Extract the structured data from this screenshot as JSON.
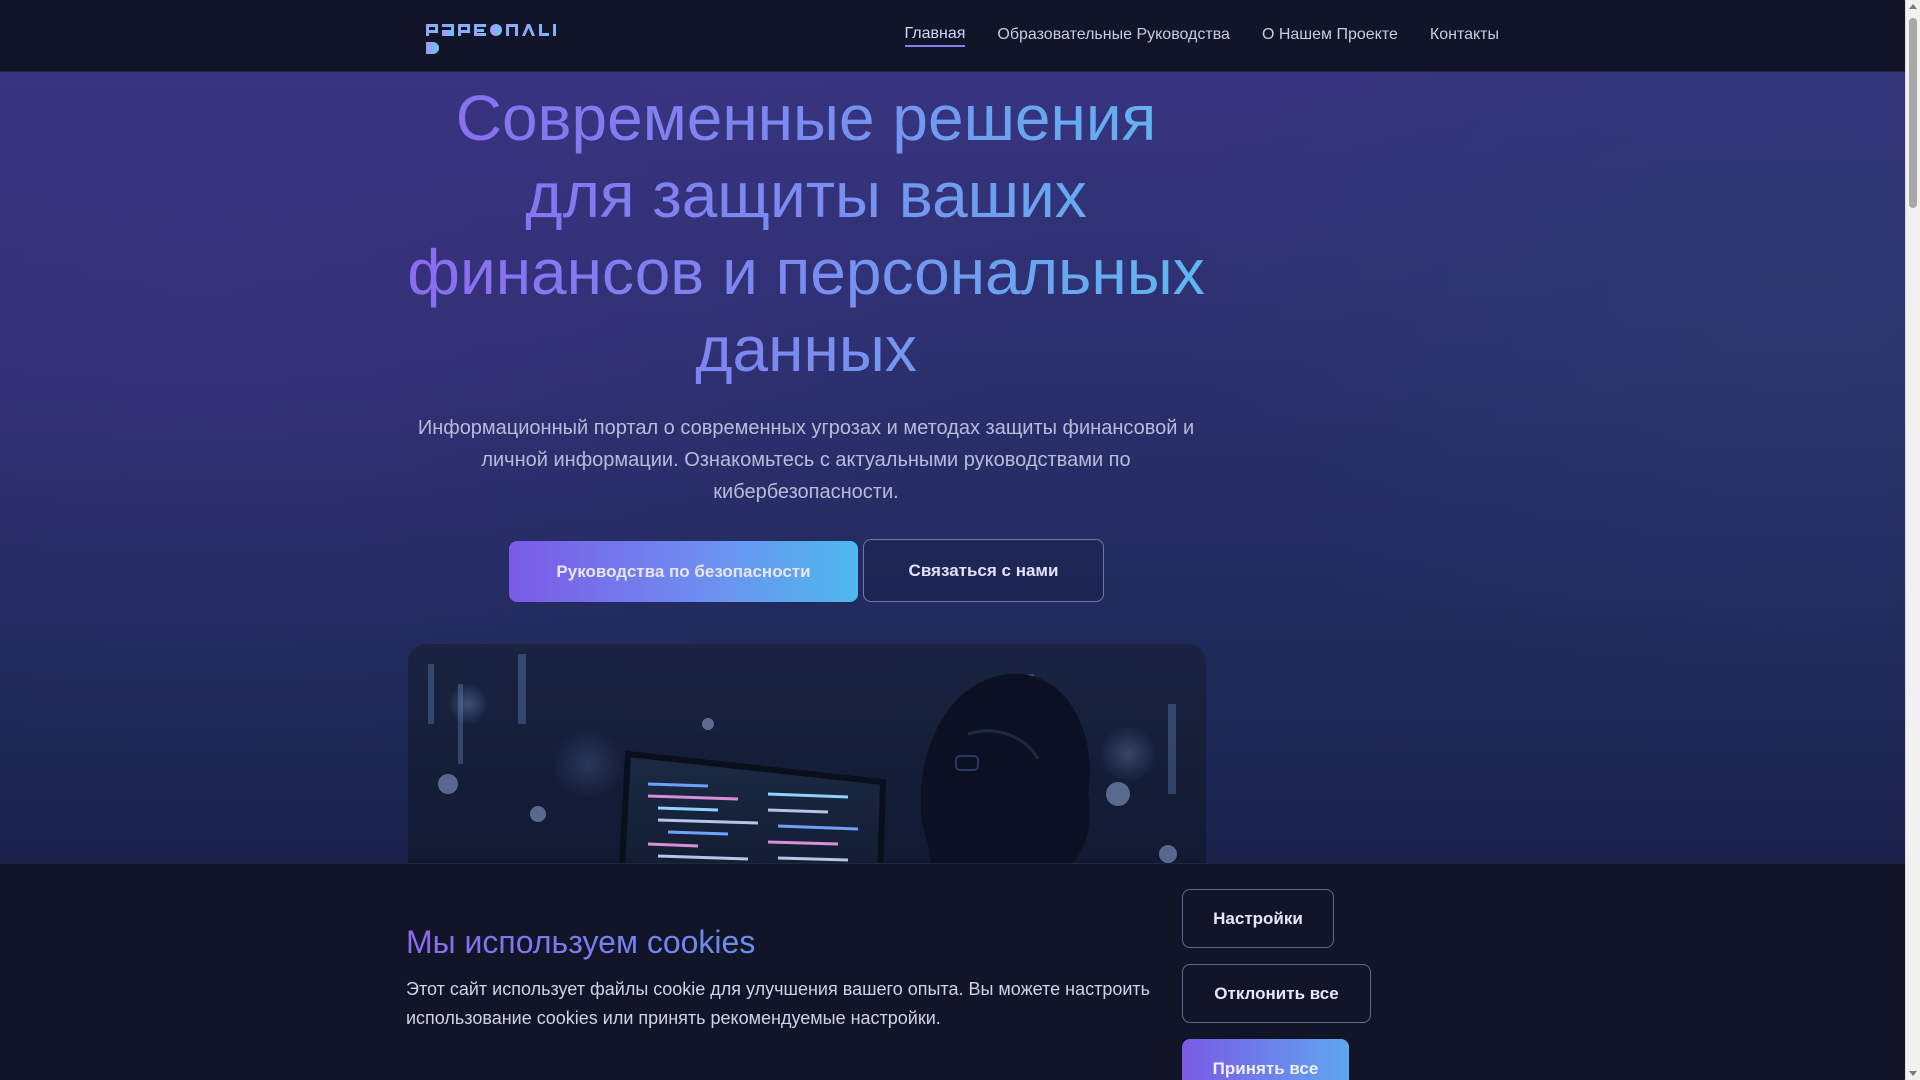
{
  "header": {
    "logo_text": "PJPEONALI D",
    "nav": [
      {
        "label": "Главная",
        "active": true
      },
      {
        "label": "Образовательные Руководства",
        "active": false
      },
      {
        "label": "О Нашем Проекте",
        "active": false
      },
      {
        "label": "Контакты",
        "active": false
      }
    ]
  },
  "hero": {
    "title": "Современные решения для защиты ваших финансов и персональных данных",
    "subtitle": "Информационный портал о современных угрозах и методах защиты финансовой и личной информации. Ознакомьтесь с актуальными руководствами по кибербезопасности.",
    "primary_button": "Руководства по безопасности",
    "secondary_button": "Связаться с нами",
    "image_icon": "person-at-computer-illustration"
  },
  "cookie_banner": {
    "title": "Мы используем cookies",
    "text": "Этот сайт использует файлы cookie для улучшения вашего опыта. Вы можете настроить использование cookies или принять рекомендуемые настройки.",
    "settings_button": "Настройки",
    "decline_button": "Отклонить все",
    "accept_button": "Принять все"
  },
  "colors": {
    "accent_purple": "#7a5ae6",
    "accent_blue": "#4fb9ee",
    "header_bg": "#121428"
  }
}
